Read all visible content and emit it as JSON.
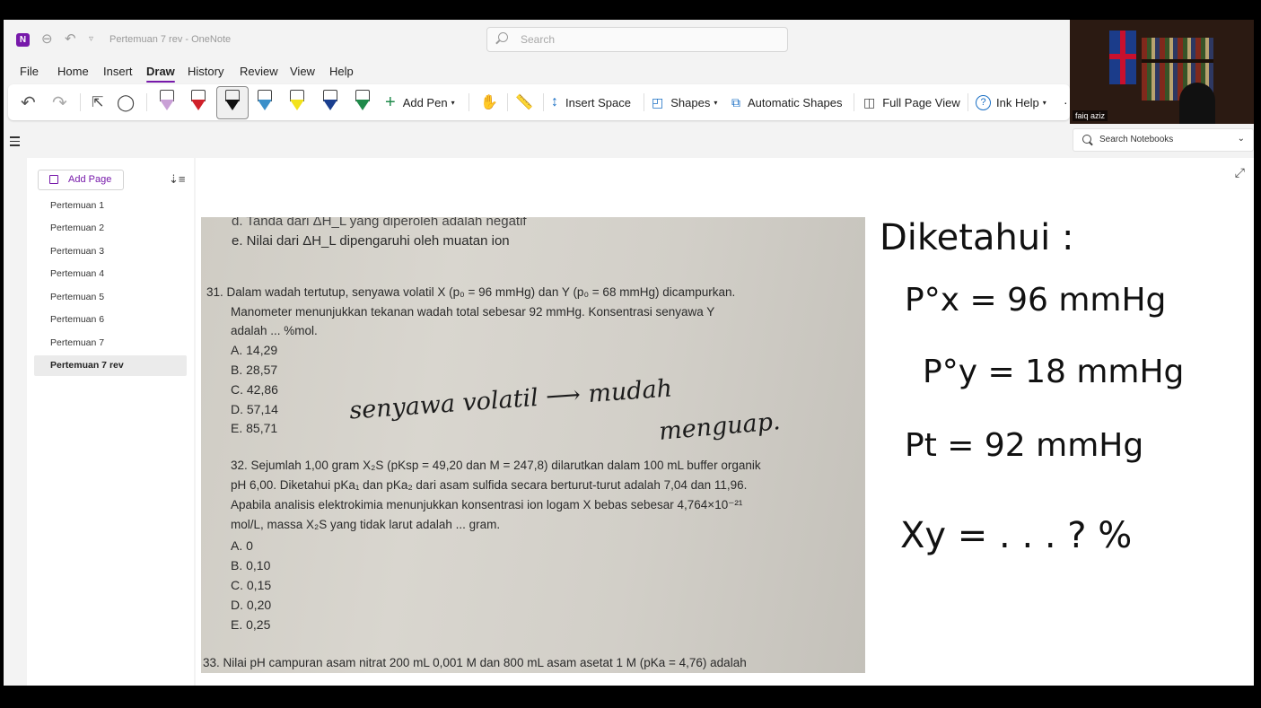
{
  "title_bar": {
    "logo": "N",
    "doc_title": "Pertemuan 7 rev - OneNote",
    "search_placeholder": "Search"
  },
  "menu": [
    "File",
    "Home",
    "Insert",
    "Draw",
    "History",
    "Review",
    "View",
    "Help"
  ],
  "active_menu": "Draw",
  "ribbon": {
    "add_pen": "Add Pen",
    "insert_space": "Insert Space",
    "shapes": "Shapes",
    "automatic_shapes": "Automatic Shapes",
    "full_page_view": "Full Page View",
    "ink_help": "Ink Help",
    "pen_colors": [
      "#c9a0d6",
      "#d0212a",
      "#111111",
      "#3b8fc9",
      "#f2e21c",
      "#1a3f8f",
      "#1f8a4a"
    ]
  },
  "video": {
    "participant_name": "faiq aziz"
  },
  "search_notebooks": "Search Notebooks",
  "pages": {
    "add_page": "Add Page",
    "items": [
      "Pertemuan 1",
      "Pertemuan 2",
      "Pertemuan 3",
      "Pertemuan 4",
      "Pertemuan 5",
      "Pertemuan 6",
      "Pertemuan 7",
      "Pertemuan 7 rev"
    ],
    "selected": "Pertemuan 7 rev"
  },
  "photo": {
    "line_d": "d.  Tanda dari ΔH_L yang diperoleh adalah negatif",
    "line_e": "e.  Nilai dari ΔH_L dipengaruhi oleh muatan ion",
    "q31": [
      "31. Dalam wadah tertutup, senyawa volatil X (p₀ = 96 mmHg) dan Y (p₀ = 68 mmHg) dicampurkan.",
      "Manometer menunjukkan tekanan wadah total sebesar 92 mmHg. Konsentrasi senyawa Y",
      "adalah ... %mol."
    ],
    "q31_options": [
      "A.   14,29",
      "B.   28,57",
      "C.   42,86",
      "D.   57,14",
      "E.   85,71"
    ],
    "q32": [
      "32. Sejumlah 1,00 gram X₂S (pKsp = 49,20 dan M = 247,8) dilarutkan dalam 100 mL buffer organik",
      "pH 6,00. Diketahui pKa₁ dan pKa₂ dari asam sulfida secara berturut-turut adalah 7,04 dan 11,96.",
      "Apabila analisis elektrokimia menunjukkan konsentrasi ion logam X bebas sebesar 4,764×10⁻²¹",
      "mol/L, massa X₂S yang tidak larut adalah ... gram."
    ],
    "q32_options": [
      "A.   0",
      "B.   0,10",
      "C.   0,15",
      "D.   0,20",
      "E.   0,25"
    ],
    "q33": "33. Nilai pH campuran asam nitrat 200 mL 0,001 M dan 800 mL asam asetat 1 M (pKa = 4,76) adalah",
    "handwriting_1": "senyawa volatil ⟶ mudah",
    "handwriting_2": "menguap."
  },
  "notes": {
    "title": "Diketahui :",
    "line1": "P°x = 96 mmHg",
    "line2": "P°y = 18 mmHg",
    "line3": "Pt = 92 mmHg",
    "line4": "Xy = . . . ?  %"
  }
}
